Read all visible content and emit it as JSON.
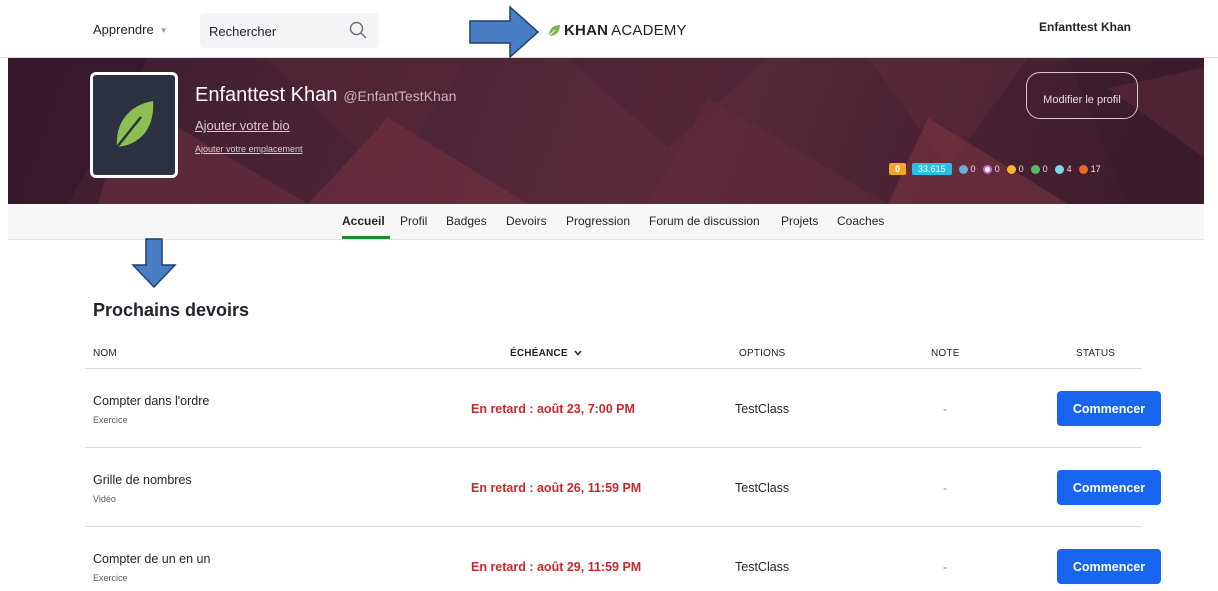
{
  "nav": {
    "learn_label": "Apprendre",
    "search_placeholder": "Rechercher",
    "logo_bold": "KHAN",
    "logo_light": "ACADEMY",
    "user_name": "Enfanttest Khan"
  },
  "profile": {
    "display_name": "Enfanttest Khan",
    "username": "@EnfantTestKhan",
    "add_bio": "Ajouter votre bio",
    "add_location": "Ajouter votre emplacement",
    "edit_profile": "Modifier le profil",
    "streak": "0",
    "points": "33.615",
    "badges": [
      "0",
      "0",
      "0",
      "0",
      "4",
      "17"
    ]
  },
  "tabs": [
    "Accueil",
    "Profil",
    "Badges",
    "Devoirs",
    "Progression",
    "Forum de discussion",
    "Projets",
    "Coaches"
  ],
  "assignments": {
    "title": "Prochains devoirs",
    "columns": {
      "name": "NOM",
      "due": "ÉCHÉANCE",
      "options": "OPTIONS",
      "grade": "NOTE",
      "status": "STATUS"
    },
    "rows": [
      {
        "title": "Compter dans l'ordre",
        "kind": "Exercice",
        "due": "En retard : août 23, 7:00 PM",
        "class": "TestClass",
        "grade": "-",
        "action": "Commencer"
      },
      {
        "title": "Grille de nombres",
        "kind": "Vidéo",
        "due": "En retard : août 26, 11:59 PM",
        "class": "TestClass",
        "grade": "-",
        "action": "Commencer"
      },
      {
        "title": "Compter de un en un",
        "kind": "Exercice",
        "due": "En retard : août 29, 11:59 PM",
        "class": "TestClass",
        "grade": "-",
        "action": "Commencer"
      }
    ]
  },
  "colors": {
    "accent_green": "#1c8a2e",
    "button_blue": "#1865f2",
    "overdue_red": "#c72a28",
    "arrow_blue": "#4a7ec4"
  }
}
